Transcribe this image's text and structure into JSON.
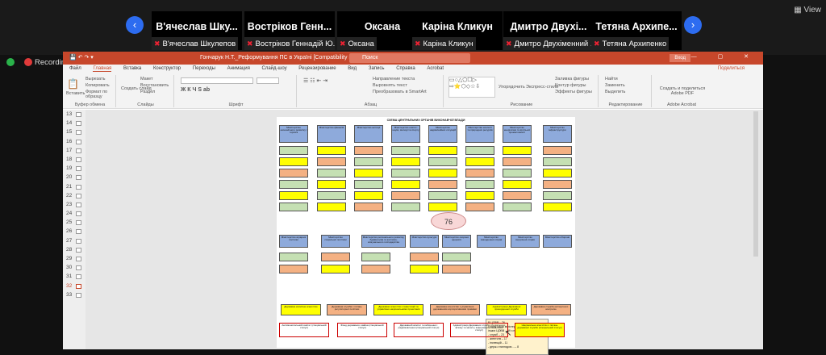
{
  "meeting": {
    "nav_prev": "‹",
    "nav_next": "›",
    "view_label": "View",
    "participants": [
      {
        "name": "В'ячеслав  Шку...",
        "label": "В'ячеслав Шкулепов"
      },
      {
        "name": "Востріков Генн...",
        "label": "Востріков Геннадій Ю..."
      },
      {
        "name": "Оксана",
        "label": "Оксана"
      },
      {
        "name": "Каріна Кликун",
        "label": "Каріна Кликун"
      },
      {
        "name": "Дмитро Двухі...",
        "label": "Дмитро Двухіменний ..."
      },
      {
        "name": "Тетяна Архипе...",
        "label": "Тетяна Архипенко"
      }
    ],
    "recording_label": "Recording"
  },
  "powerpoint": {
    "title": "Гончарук Н.Т._Реформування ПС в Україні [Compatibility Mode] - PowerPoint",
    "search_placeholder": "Поиск",
    "login_label": "Вход",
    "menu": [
      "Файл",
      "Главная",
      "Вставка",
      "Конструктор",
      "Переходы",
      "Анимация",
      "Слайд-шоу",
      "Рецензирование",
      "Вид",
      "Запись",
      "Справка",
      "Acrobat"
    ],
    "active_menu": "Главная",
    "share_label": "Поделиться",
    "ribbon_groups": [
      "Буфер обмена",
      "Слайды",
      "Шрифт",
      "Абзац",
      "Рисование",
      "Редактирование",
      "Adobe Acrobat"
    ],
    "ribbon_buttons": {
      "paste": "Вставить",
      "cut": "Вырезать",
      "copy": "Копировать",
      "format": "Формат по образцу",
      "new_slide": "Создать слайд",
      "layout": "Макет",
      "reset": "Восстановить",
      "section": "Раздел",
      "arrange": "Упорядочить",
      "styles": "Экспресс-стили",
      "find": "Найти",
      "replace": "Заменить",
      "select": "Выделить",
      "pdf": "Создать и поделиться Adobe PDF",
      "text_dir": "Направление текста",
      "align_text": "Выровнять текст",
      "smartart": "Преобразовать в SmartArt",
      "fill": "Заливка фигуры",
      "outline": "Контур фигуры",
      "effects": "Эффекты фигуры"
    },
    "slide_numbers": [
      "13",
      "14",
      "15",
      "16",
      "17",
      "18",
      "19",
      "20",
      "21",
      "22",
      "23",
      "24",
      "25",
      "26",
      "27",
      "28",
      "29",
      "30",
      "31",
      "32",
      "33"
    ],
    "selected_slide": "32"
  },
  "slide": {
    "title": "СХЕМА ЦЕНТРАЛЬНИХ ОРГАНІВ ВИКОНАВЧОЇ ВЛАДИ",
    "counter": "76",
    "row1_ministries": [
      "Міністерство економічного розвитку і торгівлі",
      "Міністерство фінансів",
      "Міністерство юстиції",
      "Міністерство освіти і науки, молоді та спорту",
      "Міністерство надзвичайних ситуацій",
      "Міністерство екології та природних ресурсів",
      "Міністерство енергетики та вугільної промисловості",
      "Міністерство інфраструктури"
    ],
    "row2_ministries": [
      "Міністерство аграрної політики",
      "Міністерство соціальної політики",
      "Міністерство регіонального розвитку, будівництва та житлово-комунального господарства",
      "Міністерство культури",
      "Міністерство охорони здоров'я",
      "Міністерство закордонних справ",
      "Міністерство внутрішніх справ",
      "Міністерство оборони"
    ],
    "bottom_row": [
      "Державне космічне агентство",
      "Державна служба з питань регуляторної політики",
      "Державне агентство з інвестицій та управління національними проектами",
      "Державне агентство з управління державними корпоративними правами",
      "Адміністрація Державної прикордонної служби",
      "Державна служба експортного контролю"
    ],
    "special_row": [
      "Антимонопольний комітет (спеціальний статус)",
      "Фонд державного майна (спеціальний статус)",
      "Державний комітет телебачення і радіомовлення (спеціальний статус)",
      "Адміністрація Державної служби спеціального зв'язку та захисту інформації (спеціальний статус)",
      "Національне агентство з питань державної служби (спеціальний статус)"
    ],
    "note_lines": [
      "В ЦОВВ – 76",
      "у тому числі міністерств – 16,",
      "інших ЦОВВ – 59 з них:",
      "- служб – 23",
      "- агентств – 17",
      "- інспекцій – 11",
      "- держ.з наглядом ...– 8"
    ]
  }
}
